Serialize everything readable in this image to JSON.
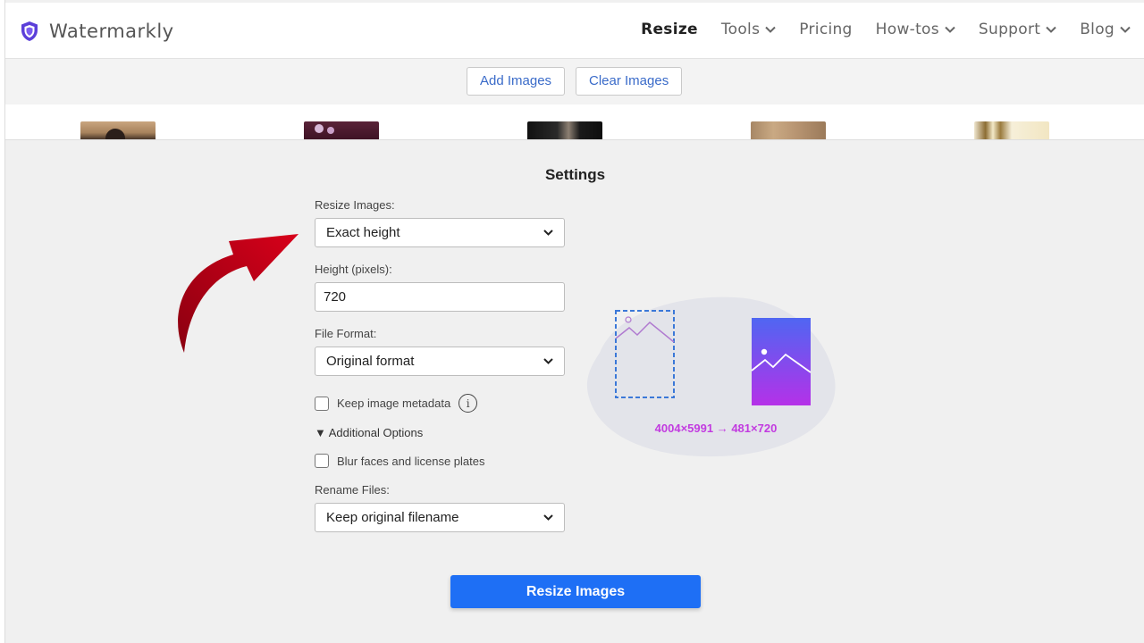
{
  "brand": {
    "name": "Watermarkly"
  },
  "nav": {
    "items": [
      {
        "label": "Resize",
        "active": true,
        "dropdown": false
      },
      {
        "label": "Tools",
        "active": false,
        "dropdown": true
      },
      {
        "label": "Pricing",
        "active": false,
        "dropdown": false
      },
      {
        "label": "How-tos",
        "active": false,
        "dropdown": true
      },
      {
        "label": "Support",
        "active": false,
        "dropdown": true
      },
      {
        "label": "Blog",
        "active": false,
        "dropdown": true
      }
    ]
  },
  "toolbar": {
    "add_label": "Add Images",
    "clear_label": "Clear Images"
  },
  "settings": {
    "title": "Settings",
    "resize_label": "Resize Images:",
    "resize_value": "Exact height",
    "height_label": "Height (pixels):",
    "height_value": "720",
    "format_label": "File Format:",
    "format_value": "Original format",
    "metadata_label": "Keep image metadata",
    "metadata_checked": false,
    "info_glyph": "i",
    "additional_label": "▼ Additional Options",
    "blur_label": "Blur faces and license plates",
    "blur_checked": false,
    "rename_label": "Rename Files:",
    "rename_value": "Keep original filename"
  },
  "preview": {
    "dimensions": "4004×5991 → 481×720"
  },
  "action": {
    "resize_label": "Resize Images"
  },
  "colors": {
    "accent": "#1e6ff5",
    "link": "#3a6bc9",
    "preview_gradient_top": "#4f66f2",
    "preview_gradient_bottom": "#b531e8",
    "arrow": "#b00010"
  },
  "icons": [
    "shield-logo-icon",
    "chevron-down-icon",
    "info-icon",
    "dropdown-caret-icon",
    "red-curved-arrow-icon"
  ]
}
